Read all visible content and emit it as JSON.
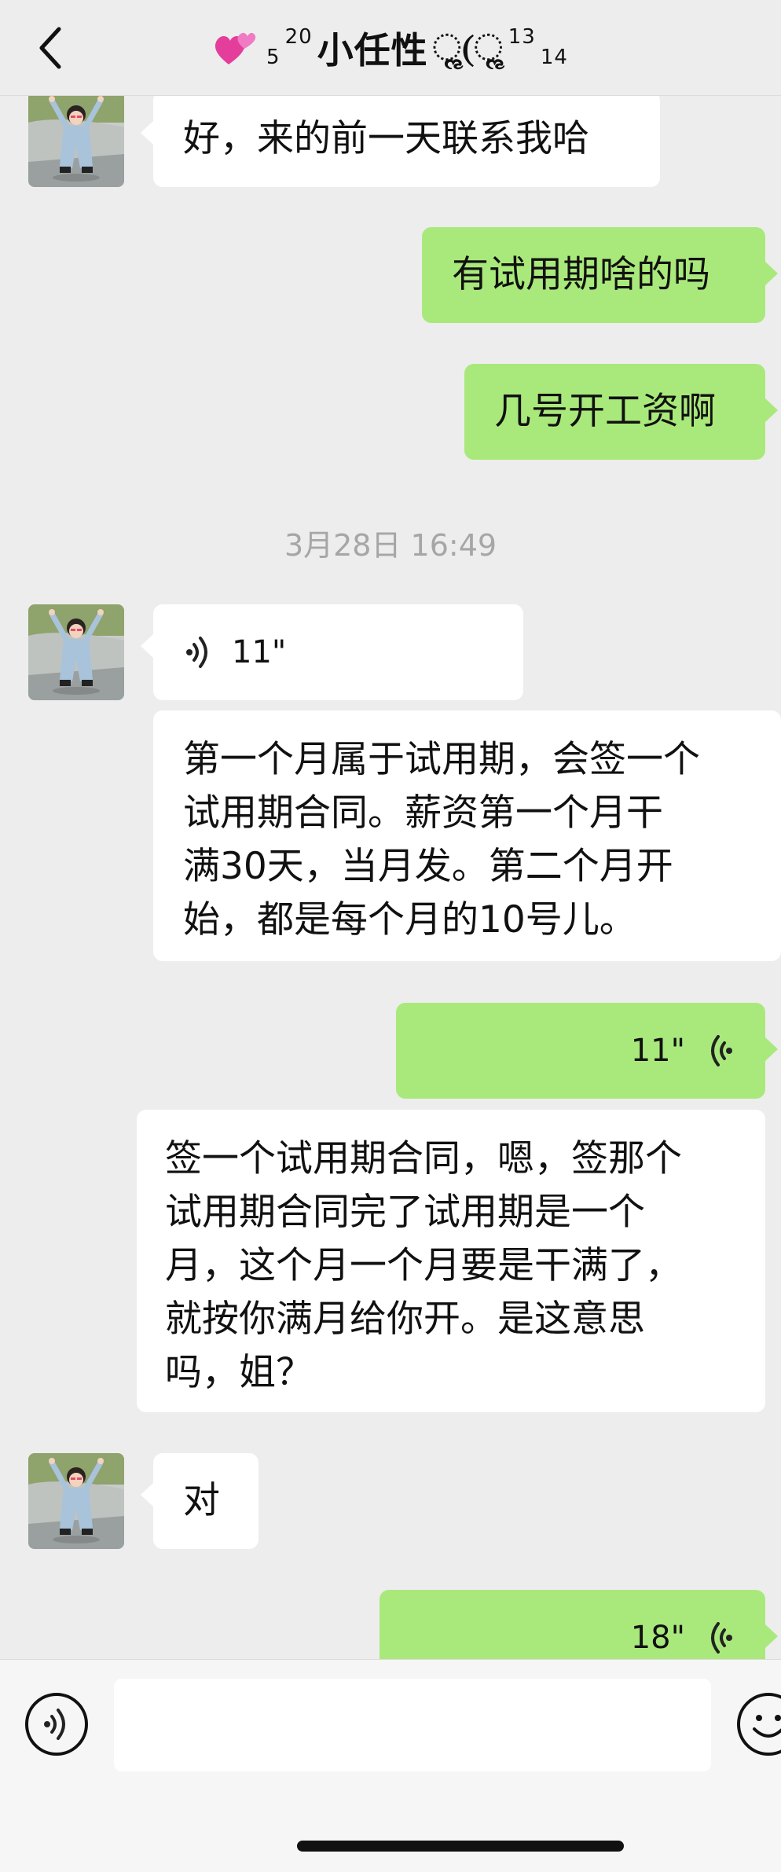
{
  "header": {
    "title": "小任性",
    "deco_left_sub": "5",
    "deco_left_sup": "20",
    "deco_right_sup": "13",
    "deco_right_sub": "14",
    "deco_glyph": "ૢ(ૢ",
    "back_icon": "chevron-left-icon",
    "heart_icon": "two-hearts-icon"
  },
  "timestamp": "3月28日 16:49",
  "messages": [
    {
      "from": "contact",
      "type": "text",
      "text": "好，来的前一天联系我哈"
    },
    {
      "from": "me",
      "type": "text",
      "text": "有试用期啥的吗"
    },
    {
      "from": "me",
      "type": "text",
      "text": "几号开工资啊"
    },
    {
      "from": "contact",
      "type": "voice",
      "duration": "11\""
    },
    {
      "from": "contact",
      "type": "text",
      "lines": [
        "第一个月属于试用期，会签一个",
        "试用期合同。薪资第一个月干",
        "满30天，当月发。第二个月开",
        "始，都是每个月的10号儿。"
      ]
    },
    {
      "from": "me",
      "type": "voice",
      "duration": "11\""
    },
    {
      "from": "me",
      "type": "text",
      "lines": [
        "签一个试用期合同，嗯，签那个",
        "试用期合同完了试用期是一个",
        "月，这个月一个月要是干满了，",
        "就按你满月给你开。是这意思",
        "吗，姐？"
      ]
    },
    {
      "from": "contact",
      "type": "text",
      "text": "对"
    },
    {
      "from": "me",
      "type": "voice",
      "duration": "18\""
    }
  ],
  "input_bar": {
    "voice_icon": "voice-input-icon",
    "emoji_icon": "emoji-icon",
    "draft": ""
  },
  "colors": {
    "background": "#ededed",
    "bubble_out": "#a9e97b",
    "bubble_in": "#ffffff",
    "timestamp": "#a6a6a6"
  }
}
